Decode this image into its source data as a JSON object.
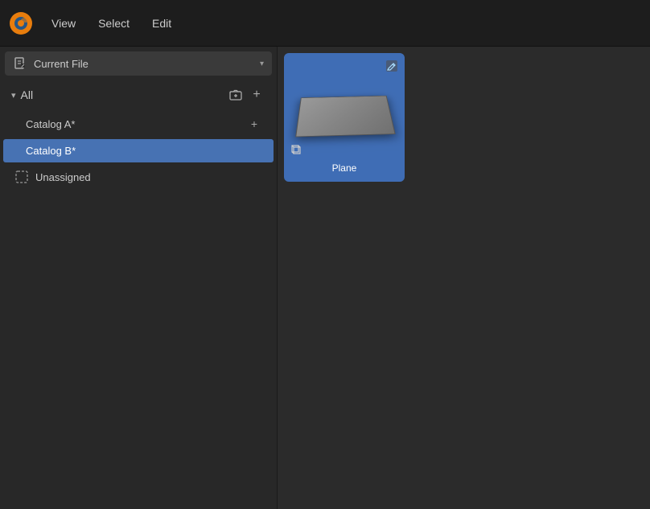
{
  "topbar": {
    "app_icon": "blender-icon",
    "menu": [
      {
        "label": "View",
        "id": "view-menu"
      },
      {
        "label": "Select",
        "id": "select-menu"
      },
      {
        "label": "Edit",
        "id": "edit-menu"
      }
    ]
  },
  "sidebar": {
    "dropdown": {
      "icon": "file-icon",
      "label": "Current File",
      "chevron": "▾"
    },
    "section": {
      "collapse_icon": "▾",
      "label": "All",
      "add_folder_btn": "⊞",
      "add_btn": "+"
    },
    "items": [
      {
        "label": "Catalog A*",
        "active": false,
        "show_add": true
      },
      {
        "label": "Catalog B*",
        "active": true,
        "show_add": false
      }
    ],
    "unassigned": {
      "icon": "unassigned-icon",
      "label": "Unassigned"
    }
  },
  "asset_grid": {
    "items": [
      {
        "label": "Plane",
        "type": "mesh",
        "top_right_icon": "edit-icon",
        "bottom_left_icon": "mesh-icon"
      }
    ]
  }
}
